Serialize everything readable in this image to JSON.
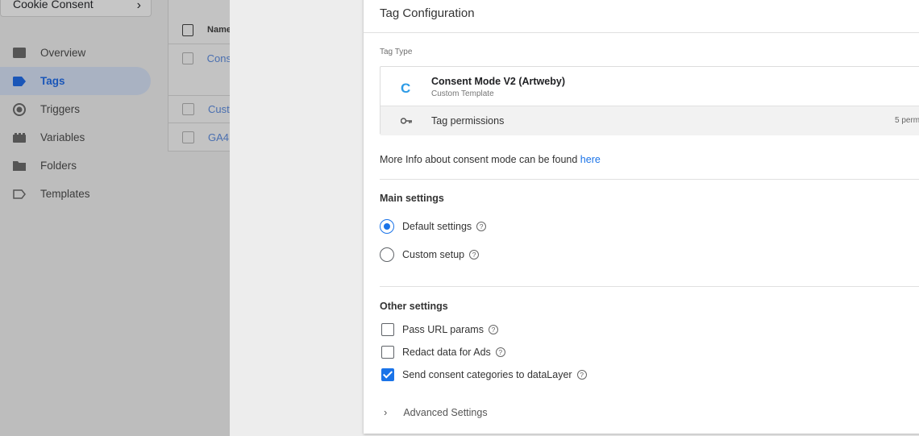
{
  "workspace": {
    "name": "Cookie Consent"
  },
  "sidebar": {
    "items": [
      {
        "label": "Overview",
        "icon": "overview-icon"
      },
      {
        "label": "Tags",
        "icon": "tag-icon",
        "active": true
      },
      {
        "label": "Triggers",
        "icon": "trigger-icon"
      },
      {
        "label": "Variables",
        "icon": "variables-icon"
      },
      {
        "label": "Folders",
        "icon": "folder-icon"
      },
      {
        "label": "Templates",
        "icon": "template-icon"
      }
    ]
  },
  "taglist": {
    "header": "Name",
    "rows": [
      "Cons",
      "Cust",
      "GA4"
    ]
  },
  "sheet": {
    "title": "Tag Configuration",
    "tag_type_label": "Tag Type",
    "tag": {
      "icon_letter": "C",
      "name": "Consent Mode V2 (Artweby)",
      "subtitle": "Custom Template"
    },
    "permissions": {
      "label": "Tag permissions",
      "count": "5 perm"
    },
    "more_info": {
      "text": "More Info about consent mode can be found",
      "link": "here"
    },
    "main_settings": {
      "title": "Main settings",
      "options": [
        {
          "label": "Default settings",
          "selected": true
        },
        {
          "label": "Custom setup",
          "selected": false
        }
      ]
    },
    "other_settings": {
      "title": "Other settings",
      "options": [
        {
          "label": "Pass URL params",
          "checked": false
        },
        {
          "label": "Redact data for Ads",
          "checked": false
        },
        {
          "label": "Send consent categories to dataLayer",
          "checked": true
        }
      ]
    },
    "advanced": {
      "label": "Advanced Settings"
    }
  },
  "colors": {
    "accent": "#1a73e8",
    "template_icon": "#2d9be6"
  }
}
